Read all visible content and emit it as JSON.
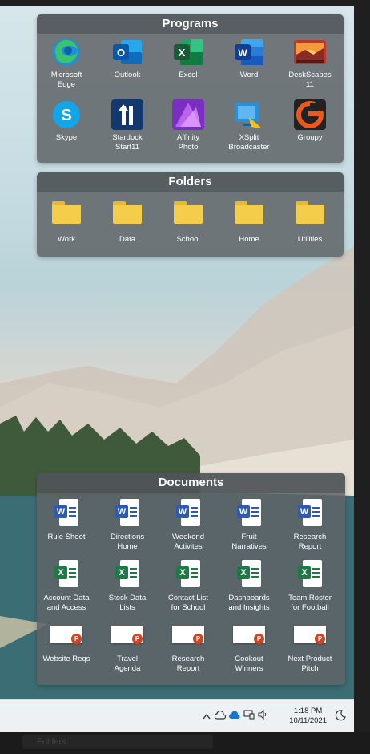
{
  "programs": {
    "title": "Programs",
    "items": [
      {
        "label": "Microsoft\nEdge",
        "icon": "edge-icon",
        "color": "#1f8fd6"
      },
      {
        "label": "Outlook",
        "icon": "outlook-icon",
        "color": "#0f6cbd"
      },
      {
        "label": "Excel",
        "icon": "excel-icon",
        "color": "#1e7a45"
      },
      {
        "label": "Word",
        "icon": "word-icon",
        "color": "#2b5bb5"
      },
      {
        "label": "DeskScapes\n11",
        "icon": "deskscapes-icon",
        "color": "#c8452a"
      },
      {
        "label": "Skype",
        "icon": "skype-icon",
        "color": "#12a5e8"
      },
      {
        "label": "Stardock\nStart11",
        "icon": "start11-icon",
        "color": "#1a4f8f"
      },
      {
        "label": "Affinity\nPhoto",
        "icon": "affinity-photo-icon",
        "color": "#9b3bd8"
      },
      {
        "label": "XSplit\nBroadcaster",
        "icon": "xsplit-icon",
        "color": "#2b8fd6"
      },
      {
        "label": "Groupy",
        "icon": "groupy-icon",
        "color": "#ea5a1c"
      }
    ]
  },
  "folders": {
    "title": "Folders",
    "items": [
      {
        "label": "Work"
      },
      {
        "label": "Data"
      },
      {
        "label": "School"
      },
      {
        "label": "Home"
      },
      {
        "label": "Utilities"
      }
    ]
  },
  "documents": {
    "title": "Documents",
    "items": [
      {
        "label": "Rule Sheet",
        "type": "word"
      },
      {
        "label": "Directions\nHome",
        "type": "word"
      },
      {
        "label": "Weekend\nActivites",
        "type": "word"
      },
      {
        "label": "Fruit\nNarratives",
        "type": "word"
      },
      {
        "label": "Research\nReport",
        "type": "word"
      },
      {
        "label": "Account Data\nand Access",
        "type": "excel"
      },
      {
        "label": "Stock Data\nLists",
        "type": "excel"
      },
      {
        "label": "Contact List\nfor School",
        "type": "excel"
      },
      {
        "label": "Dashboards\nand Insights",
        "type": "excel"
      },
      {
        "label": "Team Roster\nfor Football",
        "type": "excel"
      },
      {
        "label": "Website Reqs",
        "type": "powerpoint"
      },
      {
        "label": "Travel\nAgenda",
        "type": "powerpoint"
      },
      {
        "label": "Research\nReport",
        "type": "powerpoint"
      },
      {
        "label": "Cookout\nWinners",
        "type": "powerpoint"
      },
      {
        "label": "Next Product\nPitch",
        "type": "powerpoint"
      }
    ]
  },
  "taskbar": {
    "time": "1:18 PM",
    "date": "10/11/2021",
    "tray_icons": [
      "chevron-up-icon",
      "onedrive-icon",
      "onedrive-blue-icon",
      "network-icon",
      "volume-icon",
      "moon-icon"
    ]
  },
  "background_window": {
    "label": "Folders"
  },
  "colors": {
    "word": "#2b5bb5",
    "excel": "#1e7a45",
    "powerpoint": "#d04423",
    "folder": "#f4cd4a"
  }
}
